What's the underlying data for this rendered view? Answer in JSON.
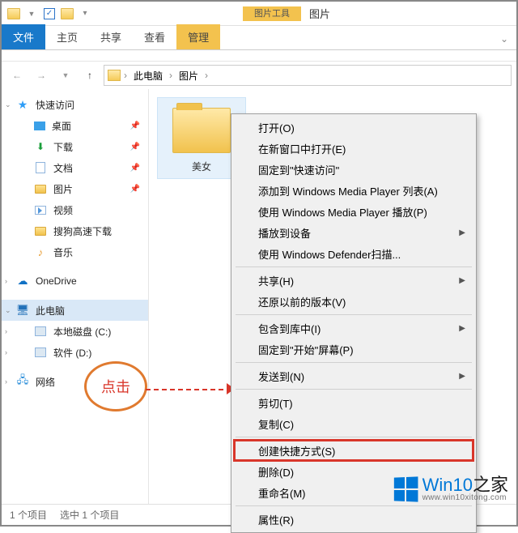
{
  "titlebar": {
    "tool_tab": "图片工具",
    "title": "图片"
  },
  "ribbon": {
    "file": "文件",
    "home": "主页",
    "share": "共享",
    "view": "查看",
    "manage": "管理"
  },
  "addressbar": {
    "root": "此电脑",
    "current": "图片"
  },
  "sidebar": {
    "quick_access": "快速访问",
    "desktop": "桌面",
    "downloads": "下载",
    "documents": "文档",
    "pictures": "图片",
    "videos": "视频",
    "sogou": "搜狗高速下载",
    "music": "音乐",
    "onedrive": "OneDrive",
    "this_pc": "此电脑",
    "disk_c": "本地磁盘 (C:)",
    "disk_d": "软件 (D:)",
    "network": "网络"
  },
  "content": {
    "folder_name": "美女"
  },
  "context_menu": {
    "open": "打开(O)",
    "open_new_window": "在新窗口中打开(E)",
    "pin_quick_access": "固定到\"快速访问\"",
    "add_wmp_list": "添加到 Windows Media Player 列表(A)",
    "play_wmp": "使用 Windows Media Player 播放(P)",
    "cast_to_device": "播放到设备",
    "defender_scan": "使用 Windows Defender扫描...",
    "share": "共享(H)",
    "restore_versions": "还原以前的版本(V)",
    "include_in_library": "包含到库中(I)",
    "pin_to_start": "固定到\"开始\"屏幕(P)",
    "send_to": "发送到(N)",
    "cut": "剪切(T)",
    "copy": "复制(C)",
    "create_shortcut": "创建快捷方式(S)",
    "delete": "删除(D)",
    "rename": "重命名(M)",
    "properties": "属性(R)"
  },
  "statusbar": {
    "item_count": "1 个项目",
    "selected": "选中 1 个项目"
  },
  "annotation": {
    "label": "点击"
  },
  "watermark": {
    "brand_a": "Win10",
    "brand_b": "之家",
    "url": "www.win10xitong.com"
  }
}
